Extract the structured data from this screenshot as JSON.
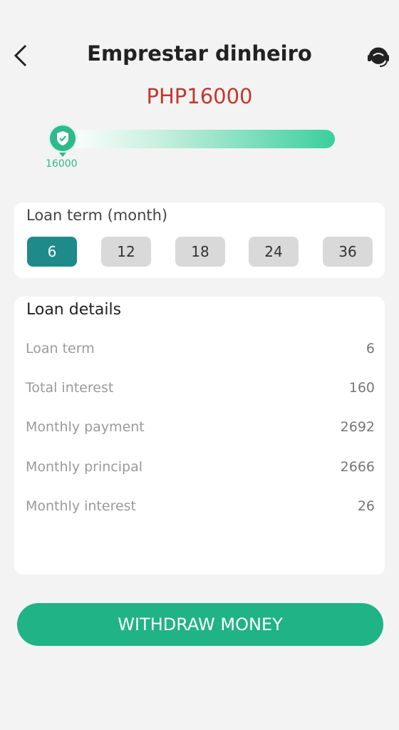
{
  "header": {
    "title": "Emprestar dinheiro"
  },
  "amount": {
    "display": "PHP16000"
  },
  "slider": {
    "value_label": "16000",
    "value": 16000
  },
  "loan_term": {
    "title": "Loan term (month)",
    "options": [
      "6",
      "12",
      "18",
      "24",
      "36"
    ],
    "selected": "6"
  },
  "loan_details": {
    "title": "Loan details",
    "rows": [
      {
        "label": "Loan term",
        "value": "6"
      },
      {
        "label": "Total interest",
        "value": "160"
      },
      {
        "label": "Monthly payment",
        "value": "2692"
      },
      {
        "label": "Monthly principal",
        "value": "2666"
      },
      {
        "label": "Monthly interest",
        "value": "26"
      }
    ]
  },
  "actions": {
    "withdraw_label": "WITHDRAW MONEY"
  },
  "colors": {
    "accent": "#1fb385",
    "selected_term": "#1f8a8a",
    "amount": "#c0392b"
  }
}
